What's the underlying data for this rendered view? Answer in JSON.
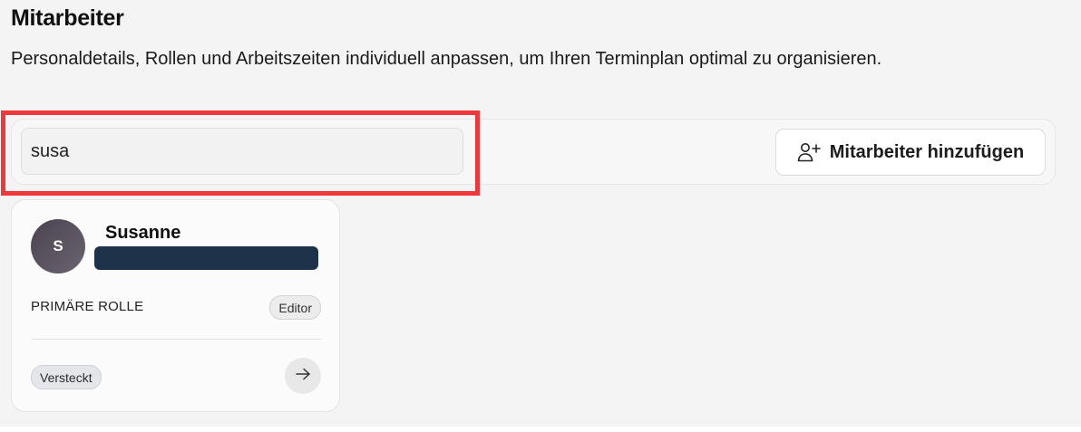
{
  "header": {
    "title": "Mitarbeiter",
    "subtitle": "Personaldetails, Rollen und Arbeitszeiten individuell anpassen, um Ihren Terminplan optimal zu organisieren."
  },
  "toolbar": {
    "search_value": "susa",
    "add_button_label": "Mitarbeiter hinzufügen",
    "add_button_icon": "user-plus-icon"
  },
  "employees": [
    {
      "initial": "S",
      "name": "Susanne",
      "role_label": "PRIMÄRE ROLLE",
      "role": "Editor",
      "status": "Versteckt",
      "action_icon": "arrow-right-icon"
    }
  ],
  "colors": {
    "highlight": "#f0373b",
    "redaction": "#1e3349",
    "avatar": "#564f5c",
    "background": "#f4f4f4"
  }
}
